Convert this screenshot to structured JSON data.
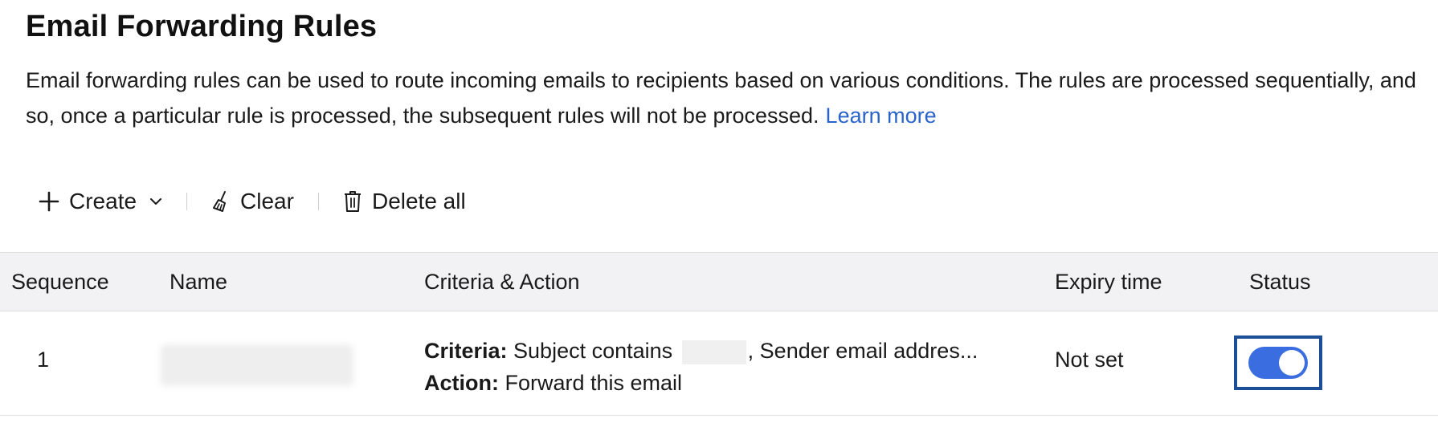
{
  "header": {
    "title": "Email Forwarding Rules",
    "description": "Email forwarding rules can be used to route incoming emails to recipients based on various conditions. The rules are processed sequentially, and so, once a particular rule is processed, the subsequent rules will not be processed.",
    "learn_more": "Learn more"
  },
  "toolbar": {
    "create_label": "Create",
    "clear_label": "Clear",
    "delete_all_label": "Delete all"
  },
  "table": {
    "columns": [
      "Sequence",
      "Name",
      "Criteria & Action",
      "Expiry time",
      "Status"
    ],
    "rows": [
      {
        "sequence": "1",
        "name": "",
        "criteria_label": "Criteria:",
        "criteria_text_before": " Subject contains ",
        "criteria_text_after": ", Sender email addres...",
        "action_label": "Action:",
        "action_text": " Forward this email",
        "expiry": "Not set",
        "status_enabled": true
      }
    ]
  },
  "colors": {
    "accent": "#3a6ee0",
    "link": "#2a63c9",
    "focus_border": "#1d4f98",
    "header_bg": "#f2f2f4"
  }
}
